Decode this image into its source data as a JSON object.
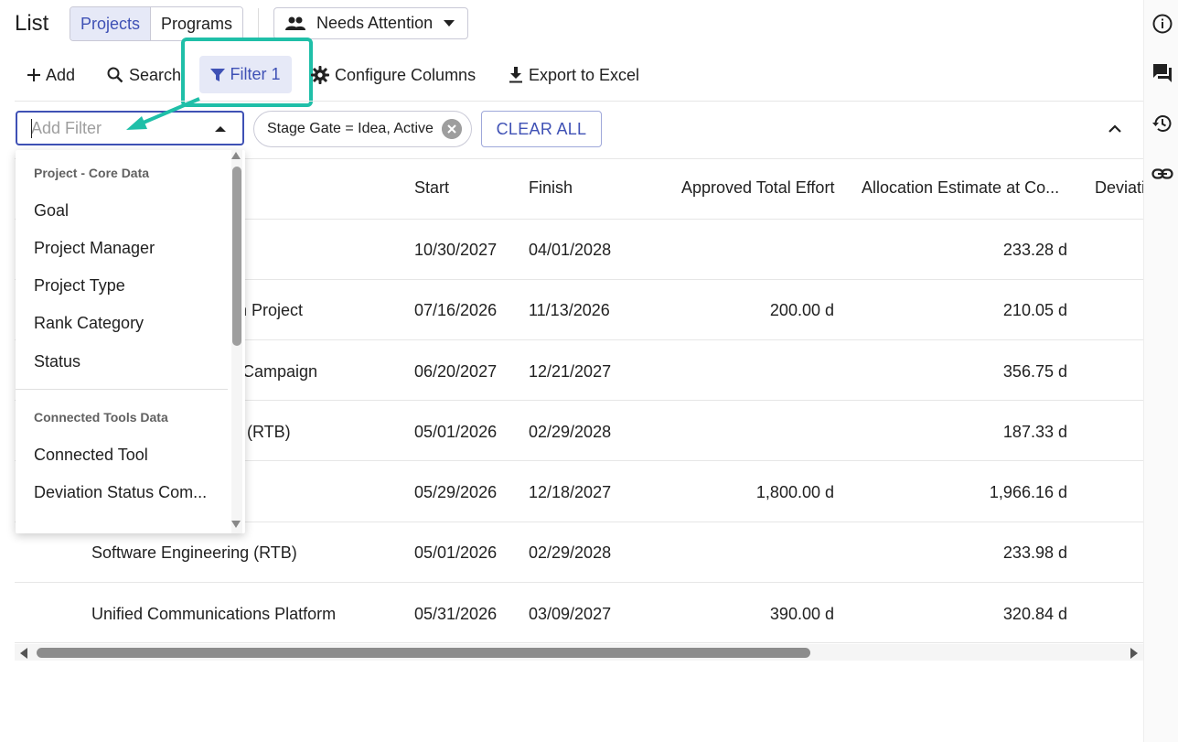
{
  "header": {
    "title": "List",
    "segments": [
      "Projects",
      "Programs"
    ],
    "view_selector": "Needs Attention"
  },
  "toolbar": {
    "add": "Add",
    "search": "Search",
    "filter": "Filter",
    "filter_count": "1",
    "configure_columns": "Configure Columns",
    "export": "Export to Excel"
  },
  "filters": {
    "add_placeholder": "Add Filter",
    "chip_label": "Stage Gate = Idea, Active",
    "clear_all": "CLEAR ALL"
  },
  "table": {
    "columns": [
      "Start",
      "Finish",
      "Approved Total Effort",
      "Allocation Estimate at Co...",
      "Deviati"
    ],
    "rows": [
      {
        "name": "",
        "start": "10/30/2027",
        "finish": "04/01/2028",
        "approved": "",
        "allocation": "233.28 d"
      },
      {
        "name": "on Project",
        "start": "07/16/2026",
        "finish": "11/13/2026",
        "approved": "200.00 d",
        "allocation": "210.05 d"
      },
      {
        "name": "n Campaign",
        "start": "06/20/2027",
        "finish": "12/21/2027",
        "approved": "",
        "allocation": "356.75 d"
      },
      {
        "name": "s (RTB)",
        "start": "05/01/2026",
        "finish": "02/29/2028",
        "approved": "",
        "allocation": "187.33 d"
      },
      {
        "name": "",
        "start": "05/29/2026",
        "finish": "12/18/2027",
        "approved": "1,800.00 d",
        "allocation": "1,966.16 d"
      },
      {
        "name": "Software Engineering (RTB)",
        "start": "05/01/2026",
        "finish": "02/29/2028",
        "approved": "",
        "allocation": "233.98 d"
      },
      {
        "name": "Unified Communications Platform",
        "start": "05/31/2026",
        "finish": "03/09/2027",
        "approved": "390.00 d",
        "allocation": "320.84 d"
      }
    ]
  },
  "dropdown": {
    "group1": "Project - Core Data",
    "group1_items": [
      "Goal",
      "Project Manager",
      "Project Type",
      "Rank Category",
      "Status"
    ],
    "group2": "Connected Tools Data",
    "group2_items": [
      "Connected Tool",
      "Deviation Status Com..."
    ]
  },
  "rail_icons": [
    "info-icon",
    "comments-icon",
    "history-icon",
    "link-icon"
  ],
  "colors": {
    "accent": "#3f51b5",
    "accent_bg": "#e6e9f7",
    "highlight": "#1fbfa8"
  }
}
